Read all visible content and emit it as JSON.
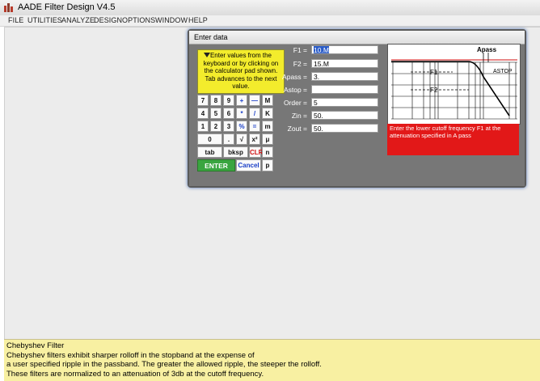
{
  "window": {
    "title": "AADE Filter Design V4.5"
  },
  "menu": [
    "FILE",
    "UTILITIES",
    "ANALYZE",
    "DESIGN",
    "OPTIONS",
    "WINDOW",
    "HELP"
  ],
  "dialog": {
    "title": "Enter data",
    "help": "Enter values from the keyboard or by clicking on the calculator pad shown. Tab advances to the next value.",
    "fields": [
      {
        "label": "F1 =",
        "value": "10.M"
      },
      {
        "label": "F2 =",
        "value": "15.M"
      },
      {
        "label": "Apass =",
        "value": "3."
      },
      {
        "label": "Astop =",
        "value": ""
      },
      {
        "label": "Order =",
        "value": "5"
      },
      {
        "label": "Zin =",
        "value": "50."
      },
      {
        "label": "Zout =",
        "value": "50."
      }
    ],
    "keypad": {
      "row1": [
        "7",
        "8",
        "9",
        "+",
        "—",
        "M"
      ],
      "row2": [
        "4",
        "5",
        "6",
        "*",
        "/",
        "K"
      ],
      "row3": [
        "1",
        "2",
        "3",
        "%",
        "=",
        "m"
      ],
      "row4": [
        "0",
        ".",
        "√",
        "x²",
        "μ"
      ],
      "row5": [
        "tab",
        "bksp",
        "CLR",
        "n"
      ],
      "row6": [
        "ENTER",
        "Cancel",
        "p"
      ]
    },
    "graph": {
      "apass_label": "Apass",
      "astop_label": "ASTOP",
      "f1_label": "F1",
      "f2_label": "F2"
    },
    "message": "Enter the lower cutoff frequency F1 at the attenuation specified in A pass"
  },
  "info": {
    "lines": [
      "Chebyshev Filter",
      "Chebyshev filters exhibit sharper rolloff in the stopband at the expense of",
      "a user specified ripple in the passband. The greater the allowed ripple, the steeper the rolloff.",
      "These filters are normalized to an attenuation of 3db at the cutoff frequency."
    ]
  },
  "colors": {
    "help_bg": "#f3ec2c",
    "message_bg": "#e21818",
    "info_bg": "#f8f0a2",
    "enter_bg": "#3aa540"
  }
}
